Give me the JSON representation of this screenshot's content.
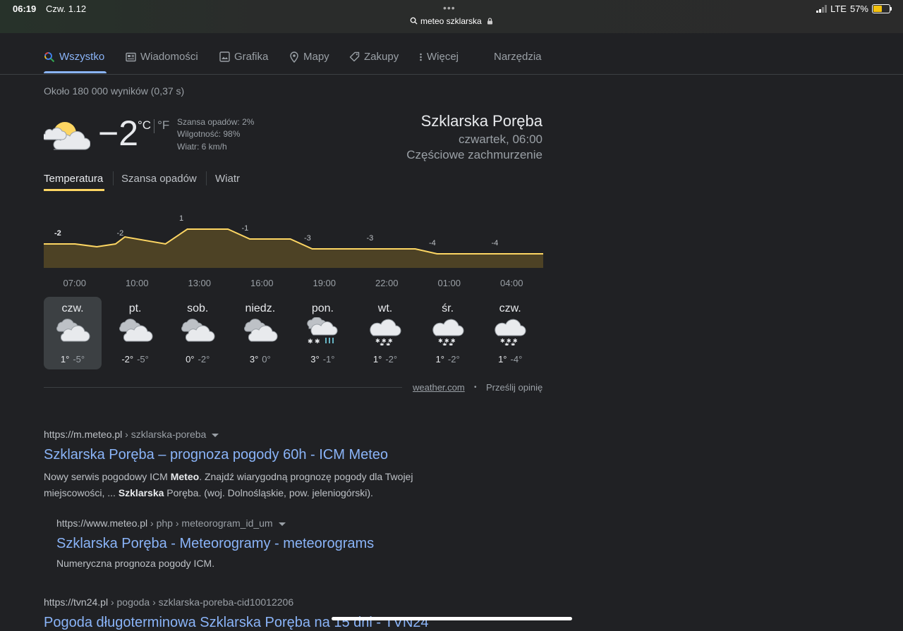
{
  "status_bar": {
    "time": "06:19",
    "date": "Czw. 1.12",
    "url": "meteo szklarska",
    "network": "LTE",
    "battery": "57%"
  },
  "tabs": [
    {
      "label": "Wszystko",
      "icon": "search-icon",
      "active": true
    },
    {
      "label": "Wiadomości",
      "icon": "news-icon"
    },
    {
      "label": "Grafika",
      "icon": "image-icon"
    },
    {
      "label": "Mapy",
      "icon": "map-pin-icon"
    },
    {
      "label": "Zakupy",
      "icon": "tag-icon"
    },
    {
      "label": "Więcej",
      "icon": "more-vert-icon"
    }
  ],
  "tools_label": "Narzędzia",
  "results_count": "Około 180 000 wyników (0,37 s)",
  "weather": {
    "temp": "−2",
    "unit_c": "°C",
    "unit_f": "°F",
    "precip": "Szansa opadów: 2%",
    "humidity": "Wilgotność: 98%",
    "wind": "Wiatr: 6 km/h",
    "location": "Szklarska Poręba",
    "datetime": "czwartek, 06:00",
    "condition": "Częściowe zachmurzenie",
    "icon": "partly-cloudy-icon",
    "tabs": [
      "Temperatura",
      "Szansa opadów",
      "Wiatr"
    ],
    "source": "weather.com",
    "feedback": "Prześlij opinię"
  },
  "chart_data": {
    "type": "area",
    "x": [
      "07:00",
      "10:00",
      "13:00",
      "16:00",
      "19:00",
      "22:00",
      "01:00",
      "04:00"
    ],
    "values": [
      -2,
      -2,
      1,
      -1,
      -3,
      -3,
      -4,
      -4
    ],
    "color": "#fdd663"
  },
  "forecast": [
    {
      "day": "czw.",
      "hi": "1°",
      "lo": "-5°",
      "icon": "cloudy-icon",
      "selected": true
    },
    {
      "day": "pt.",
      "hi": "-2°",
      "lo": "-5°",
      "icon": "cloudy-icon"
    },
    {
      "day": "sob.",
      "hi": "0°",
      "lo": "-2°",
      "icon": "cloudy-icon"
    },
    {
      "day": "niedz.",
      "hi": "3°",
      "lo": "0°",
      "icon": "cloudy-icon"
    },
    {
      "day": "pon.",
      "hi": "3°",
      "lo": "-1°",
      "icon": "snow-rain-icon"
    },
    {
      "day": "wt.",
      "hi": "1°",
      "lo": "-2°",
      "icon": "snow-icon"
    },
    {
      "day": "śr.",
      "hi": "1°",
      "lo": "-2°",
      "icon": "snow-icon"
    },
    {
      "day": "czw.",
      "hi": "1°",
      "lo": "-4°",
      "icon": "snow-icon"
    }
  ],
  "results": [
    {
      "url": "https://m.meteo.pl",
      "crumb": " › szklarska-poreba",
      "title": "Szklarska Poręba – prognoza pogody 60h - ICM Meteo",
      "snippet_1a": "Nowy serwis pogodowy ICM ",
      "snippet_1b": "Meteo",
      "snippet_1c": ". Znajdź wiarygodną prognozę pogody dla Twojej",
      "snippet_2a": "miejscowości, ... ",
      "snippet_2b": "Szklarska",
      "snippet_2c": " Poręba. (woj. Dolnośląskie, pow. jeleniogórski)."
    },
    {
      "url": "https://www.meteo.pl",
      "crumb": " › php › meteorogram_id_um",
      "title": "Szklarska Poręba - Meteorogramy - meteorograms",
      "snippet": "Numeryczna prognoza pogody ICM."
    },
    {
      "url": "https://tvn24.pl",
      "crumb": " › pogoda › szklarska-poreba-cid10012206",
      "title": "Pogoda długoterminowa Szklarska Poręba na 15 dni - TVN24"
    }
  ]
}
